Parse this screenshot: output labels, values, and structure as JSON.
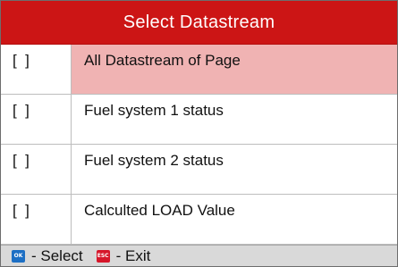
{
  "header": {
    "title": "Select Datastream"
  },
  "rows": [
    {
      "check": "[  ]",
      "label": "All Datastream of Page"
    },
    {
      "check": "[  ]",
      "label": "Fuel system 1 status"
    },
    {
      "check": "[  ]",
      "label": "Fuel system 2 status"
    },
    {
      "check": "[  ]",
      "label": "Calculted LOAD Value"
    }
  ],
  "footer": {
    "ok_icon_text": "OK",
    "select_label": "- Select",
    "esc_icon_text": "ESC",
    "exit_label": "- Exit",
    "ok_icon_name": "ok-key-icon",
    "esc_icon_name": "esc-key-icon"
  },
  "colors": {
    "header": "#cc1515",
    "selected_row": "#f0b3b3",
    "footer": "#d9d9d9",
    "ok_icon": "#1d6fc4",
    "esc_icon": "#d6162a"
  }
}
